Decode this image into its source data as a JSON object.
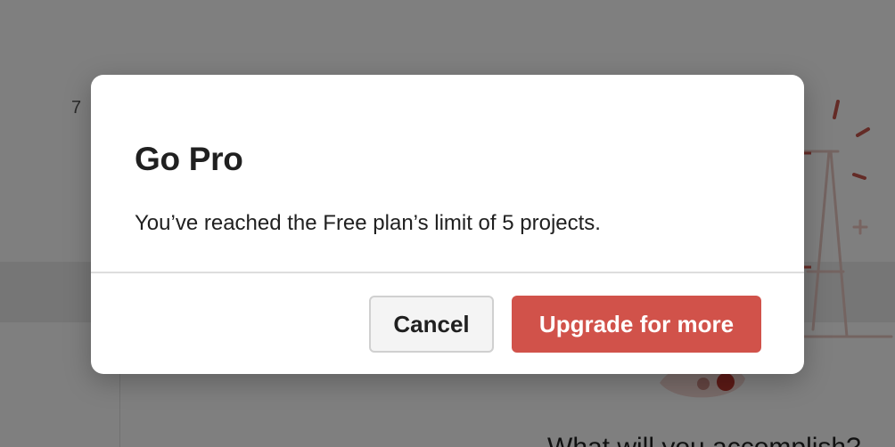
{
  "background": {
    "number_label": "7",
    "prompt_text": "What will you accomplish?"
  },
  "modal": {
    "title": "Go Pro",
    "message": "You’ve reached the Free plan’s limit of 5 projects.",
    "cancel_label": "Cancel",
    "upgrade_label": "Upgrade for more"
  },
  "colors": {
    "accent": "#d1524a",
    "overlay": "rgba(0,0,0,0.5)",
    "illustration": "#c9574c"
  },
  "icons": [
    "sparkle-lines-icon",
    "plus-sparkle-icon",
    "easel-illustration"
  ]
}
